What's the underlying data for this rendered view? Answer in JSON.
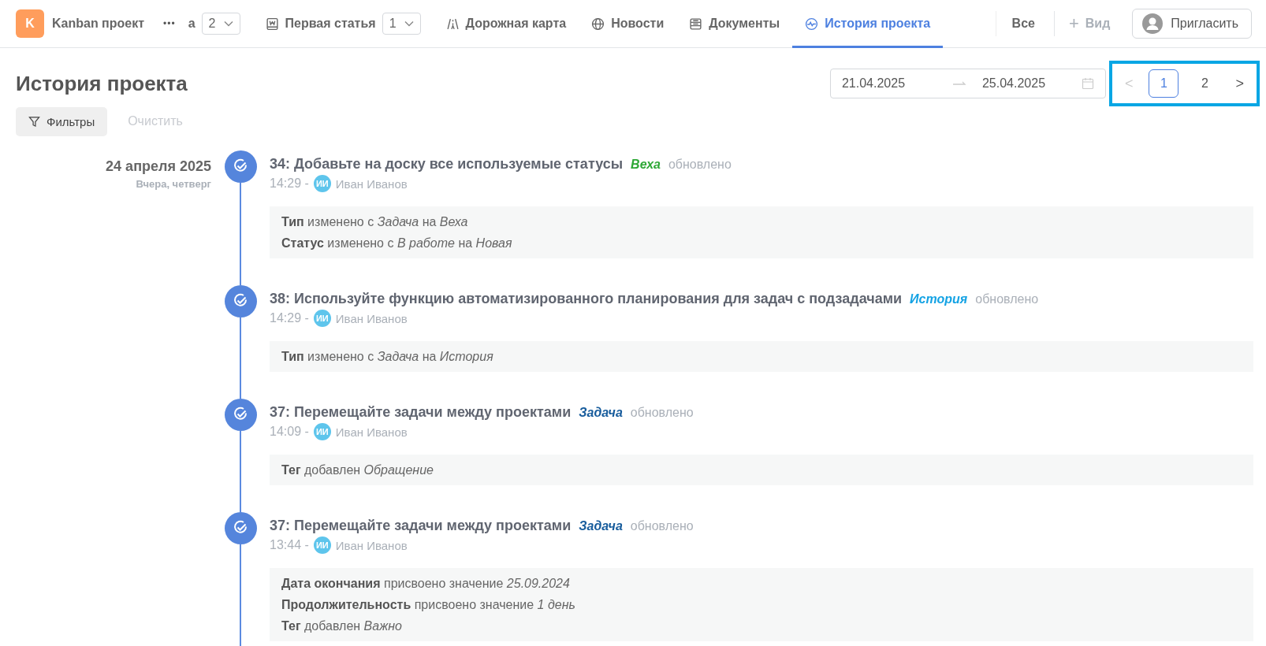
{
  "project": {
    "logo_letter": "K",
    "name": "Kanban проект",
    "more": "•••"
  },
  "tabs": [
    {
      "kind": "counter",
      "label": "а",
      "count": "2",
      "selected": false
    },
    {
      "kind": "article",
      "label": "Первая статья",
      "count": "1",
      "selected": false
    },
    {
      "kind": "roadmap",
      "label": "Дорожная карта",
      "selected": false
    },
    {
      "kind": "news",
      "label": "Новости",
      "selected": false
    },
    {
      "kind": "docs",
      "label": "Документы",
      "selected": false
    },
    {
      "kind": "history",
      "label": "История проекта",
      "selected": true
    }
  ],
  "all_tab": "Все",
  "add_view": {
    "plus": "+",
    "label": "Вид"
  },
  "invite_button": "Пригласить",
  "page_title": "История проекта",
  "date_range": {
    "from": "21.04.2025",
    "to": "25.04.2025"
  },
  "pagination": {
    "prev": "<",
    "next": ">",
    "pages": [
      {
        "label": "1",
        "selected": true
      },
      {
        "label": "2",
        "selected": false
      }
    ]
  },
  "filters_button": "Фильтры",
  "clear_button": "Очистить",
  "day": {
    "date": "24 апреля 2025",
    "subtitle": "Вчера, четверг"
  },
  "events": [
    {
      "title": "34: Добавьте на доску все используемые статусы",
      "type": "Веха",
      "color": "#2ea836",
      "action": "обновлено",
      "time": "14:29 -",
      "avatar": "ИИ",
      "user": "Иван Иванов",
      "changes": [
        "**Тип** изменено с *Задача* на *Веха*",
        "**Статус** изменено с *В работе* на *Новая*"
      ]
    },
    {
      "title": "38: Используйте функцию автоматизированного планирования для задач с подзадачами",
      "type": "История",
      "color": "#15a3e4",
      "action": "обновлено",
      "time": "14:29 -",
      "avatar": "ИИ",
      "user": "Иван Иванов",
      "changes": [
        "**Тип** изменено с *Задача* на *История*"
      ]
    },
    {
      "title": "37: Перемещайте задачи между проектами",
      "type": "Задача",
      "color": "#175c9c",
      "action": "обновлено",
      "time": "14:09 -",
      "avatar": "ИИ",
      "user": "Иван Иванов",
      "changes": [
        "**Тег** добавлен *Обращение*"
      ]
    },
    {
      "title": "37: Перемещайте задачи между проектами",
      "type": "Задача",
      "color": "#175c9c",
      "action": "обновлено",
      "time": "13:44 -",
      "avatar": "ИИ",
      "user": "Иван Иванов",
      "changes": [
        "**Дата окончания** присвоено значение *25.09.2024*",
        "**Продолжительность** присвоено значение *1 день*",
        "**Тег** добавлен *Важно*"
      ]
    }
  ]
}
